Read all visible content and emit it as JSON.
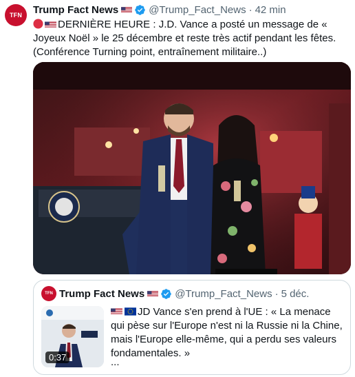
{
  "post": {
    "author_name": "Trump Fact News",
    "handle": "@Trump_Fact_News",
    "separator": "·",
    "time": "42 min",
    "avatar_text": "TFN",
    "text": "DERNIÈRE HEURE : J.D. Vance a posté un message de « Joyeux Noël » le 25 décembre et reste très actif pendant les fêtes. (Conférence Turning point, entraînement militaire..)"
  },
  "quote": {
    "author_name": "Trump Fact News",
    "handle": "@Trump_Fact_News",
    "separator": "·",
    "time": "5 déc.",
    "text": "JD Vance s'en prend à l'UE : « La menace qui pèse sur l'Europe n'est ni la Russie ni la Chine, mais l'Europe elle-même, qui a perdu ses valeurs fondamentales. »",
    "ellipsis": "...",
    "video_duration": "0:37"
  },
  "colors": {
    "accent": "#1d9bf0",
    "muted": "#536471",
    "brand_red": "#c8102e"
  },
  "icons": [
    "us-flag-icon",
    "verified-badge-icon",
    "red-circle-icon",
    "eu-flag-icon"
  ]
}
